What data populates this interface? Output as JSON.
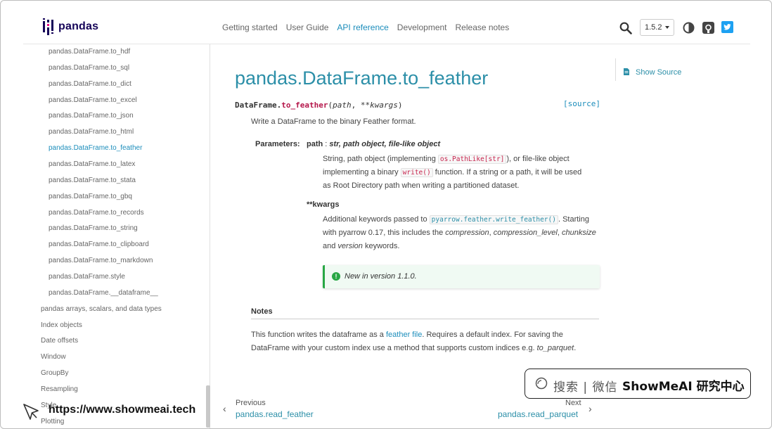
{
  "header": {
    "logo_text": "pandas",
    "nav": [
      "Getting started",
      "User Guide",
      "API reference",
      "Development",
      "Release notes"
    ],
    "active_nav": "API reference",
    "version": "1.5.2"
  },
  "sidebar": {
    "sub_items": [
      "pandas.DataFrame.to_hdf",
      "pandas.DataFrame.to_sql",
      "pandas.DataFrame.to_dict",
      "pandas.DataFrame.to_excel",
      "pandas.DataFrame.to_json",
      "pandas.DataFrame.to_html",
      "pandas.DataFrame.to_feather",
      "pandas.DataFrame.to_latex",
      "pandas.DataFrame.to_stata",
      "pandas.DataFrame.to_gbq",
      "pandas.DataFrame.to_records",
      "pandas.DataFrame.to_string",
      "pandas.DataFrame.to_clipboard",
      "pandas.DataFrame.to_markdown",
      "pandas.DataFrame.style",
      "pandas.DataFrame.__dataframe__"
    ],
    "active_item": "pandas.DataFrame.to_feather",
    "top_items": [
      "pandas arrays, scalars, and data types",
      "Index objects",
      "Date offsets",
      "Window",
      "GroupBy",
      "Resampling",
      "Style",
      "Plotting"
    ]
  },
  "main": {
    "title": "pandas.DataFrame.to_feather",
    "sig_obj": "DataFrame.",
    "sig_fn": "to_feather",
    "sig_open": "(",
    "sig_arg1": "path",
    "sig_sep": ", ",
    "sig_arg2": "**kwargs",
    "sig_close": ")",
    "source_link": "[source]",
    "description": "Write a DataFrame to the binary Feather format.",
    "params_label": "Parameters:",
    "param1": {
      "name": "path",
      "colon": " : ",
      "type": "str, path object, file-like object",
      "desc_1": "String, path object (implementing ",
      "code_1": "os.PathLike[str]",
      "desc_2": "), or file-like object",
      "desc_3": "implementing a binary ",
      "code_2": "write()",
      "desc_4": " function. If a string or a path, it will be used",
      "desc_5": "as Root Directory path when writing a partitioned dataset."
    },
    "param2": {
      "name": "**kwargs",
      "desc_1": "Additional keywords passed to ",
      "code_1": "pyarrow.feather.write_feather()",
      "desc_2": ". Starting",
      "desc_3": "with pyarrow 0.17, this includes the ",
      "kw1": "compression",
      "sep1": ", ",
      "kw2": "compression_level",
      "sep2": ", ",
      "kw3": "chunksize",
      "desc_4": "and ",
      "kw4": "version",
      "desc_5": " keywords."
    },
    "version_added": "New in version 1.1.0.",
    "notes": {
      "heading": "Notes",
      "p1": "This function writes the dataframe as a ",
      "link": "feather file",
      "p2": ". Requires a default index. For saving the DataFrame with your custom index use a method that supports custom indices e.g. ",
      "p3": "to_parquet",
      "p4": "."
    }
  },
  "toc": {
    "show_source": "Show Source"
  },
  "pager": {
    "prev_label": "Previous",
    "prev_link": "pandas.read_feather",
    "next_label": "Next",
    "next_link": "pandas.read_parquet"
  },
  "watermark": {
    "search_text": "搜索 | 微信",
    "brand": "ShowMeAI 研究中心",
    "url": "https://www.showmeai.tech"
  },
  "icons": {
    "search": "search-icon",
    "theme": "theme-toggle-icon",
    "github": "github-icon",
    "twitter": "twitter-icon",
    "doc": "file-icon"
  },
  "colors": {
    "link": "#1b8dbb",
    "title": "#2c8fa8",
    "brand": "#150458",
    "function_name": "#b5174b",
    "note_green": "#28a745",
    "twitter": "#1da1f2"
  }
}
